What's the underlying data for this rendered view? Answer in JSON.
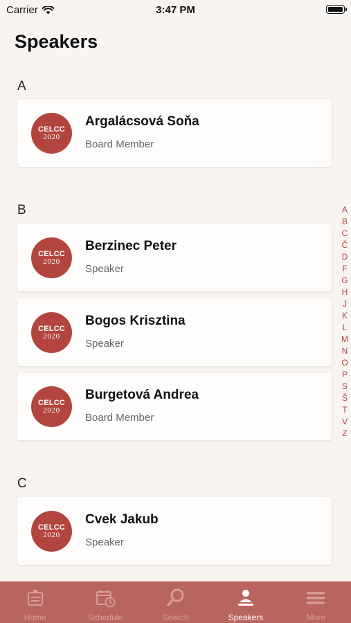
{
  "status_bar": {
    "carrier": "Carrier",
    "time": "3:47 PM"
  },
  "page_title": "Speakers",
  "sections": [
    {
      "letter": "A",
      "speakers": [
        {
          "name": "Argalácsová Soňa",
          "role": "Board Member"
        }
      ]
    },
    {
      "letter": "B",
      "speakers": [
        {
          "name": "Berzinec Peter",
          "role": "Speaker"
        },
        {
          "name": "Bogos Krisztina",
          "role": "Speaker"
        },
        {
          "name": "Burgetová Andrea",
          "role": "Board Member"
        }
      ]
    },
    {
      "letter": "C",
      "speakers": [
        {
          "name": "Cvek Jakub",
          "role": "Speaker"
        }
      ]
    }
  ],
  "avatar_logo": {
    "top": "CELCC",
    "bottom": "2020"
  },
  "index_letters": [
    "A",
    "B",
    "C",
    "Č",
    "D",
    "F",
    "G",
    "H",
    "J",
    "K",
    "L",
    "M",
    "N",
    "O",
    "P",
    "S",
    "Š",
    "T",
    "V",
    "Z"
  ],
  "tab_bar": {
    "tabs": [
      {
        "label": "Home",
        "icon": "home-icon"
      },
      {
        "label": "Schedule",
        "icon": "calendar-clock-icon"
      },
      {
        "label": "Search",
        "icon": "search-icon"
      },
      {
        "label": "Speakers",
        "icon": "person-icon",
        "active": true
      },
      {
        "label": "More",
        "icon": "menu-icon"
      }
    ]
  },
  "colors": {
    "accent": "#b3453f",
    "tab_bar": "#b9655f",
    "background": "#f8f4f1"
  }
}
